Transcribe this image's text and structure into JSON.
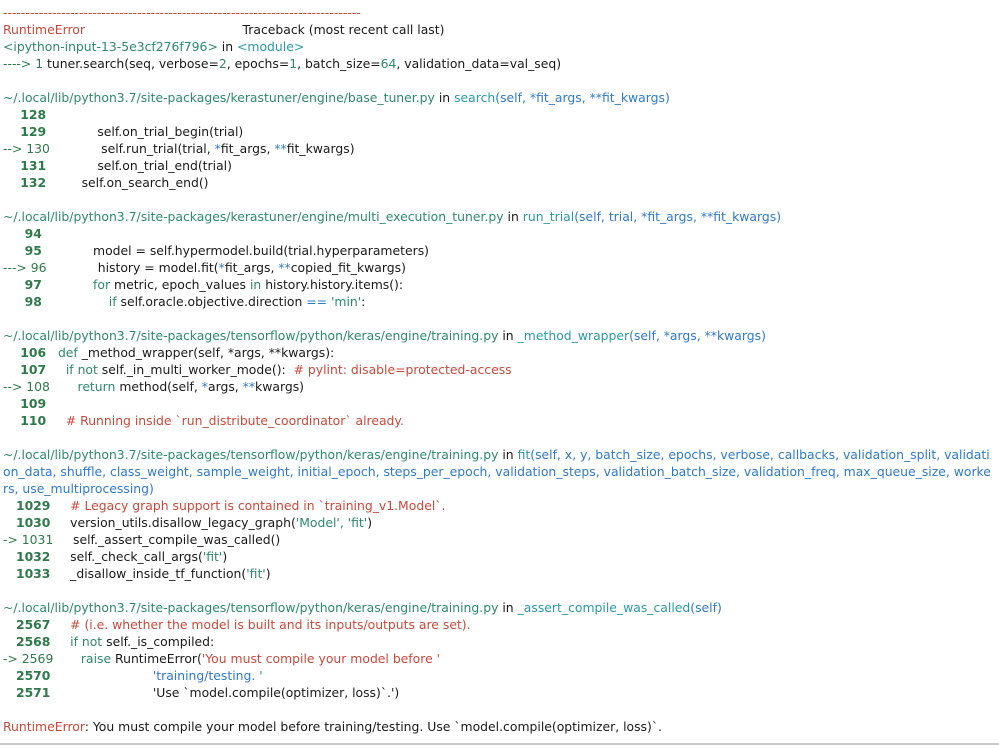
{
  "dashes": "--------------------------------------------------------------------------------",
  "header": {
    "exc_type": "RuntimeError",
    "gap": "                                        ",
    "traceback_label": "Traceback (most recent call last)"
  },
  "input": {
    "ref": "<ipython-input-13-5e3cf276f796>",
    "in": " in ",
    "module": "<module>",
    "arrow": "----> 1 ",
    "code_a": "tuner.search(seq, verbose=",
    "n2": "2",
    "code_b": ", epochs=",
    "n1": "1",
    "code_c": ", batch_size=",
    "n64": "64",
    "code_d": ", validation_data=val_seq)"
  },
  "f1": {
    "path": "~/.local/lib/python3.7/site-packages/kerastuner/engine/base_tuner.py",
    "in": " in ",
    "func": "search",
    "sig_a": "(self, ",
    "star1": "*",
    "sig_b": "fit_args, ",
    "star2": "**",
    "sig_c": "fit_kwargs)",
    "l1": "    128",
    "l2_num": "    129",
    "l2_code": "             self.on_trial_begin(trial)",
    "l3_arr": "--> 130",
    "l3_code_a": "             self.run_trial(trial, ",
    "l3_star1": "*",
    "l3_code_b": "fit_args, ",
    "l3_star2": "**",
    "l3_code_c": "fit_kwargs)",
    "l4_num": "    131",
    "l4_code": "             self.on_trial_end(trial)",
    "l5_num": "    132",
    "l5_code": "         self.on_search_end()"
  },
  "f2": {
    "path": "~/.local/lib/python3.7/site-packages/kerastuner/engine/multi_execution_tuner.py",
    "in": " in ",
    "func": "run_trial",
    "sig_a": "(self, trial, ",
    "star1": "*",
    "sig_b": "fit_args, ",
    "star2": "**",
    "sig_c": "fit_kwargs)",
    "l1": "     94",
    "l2_num": "     95",
    "l2_code": "             model = self.hypermodel.build(trial.hyperparameters)",
    "l3_arr": "---> 96",
    "l3_code_a": "             history = model.fit(",
    "l3_star1": "*",
    "l3_code_b": "fit_args, ",
    "l3_star2": "**",
    "l3_code_c": "copied_fit_kwargs)",
    "l4_num": "     97",
    "l4_for": "             for",
    "l4_code_a": " metric, epoch_values ",
    "l4_in": "in",
    "l4_code_b": " history.history.items():",
    "l5_num": "     98",
    "l5_if": "                 if",
    "l5_code_a": " self.oracle.objective.direction ",
    "l5_eq": "==",
    "l5_str": " 'min'",
    "l5_colon": ":"
  },
  "f3": {
    "path": "~/.local/lib/python3.7/site-packages/tensorflow/python/keras/engine/training.py",
    "in": " in ",
    "func": "_method_wrapper",
    "sig_a": "(self, ",
    "star1": "*",
    "sig_b": "args, ",
    "star2": "**",
    "sig_c": "kwargs)",
    "l1_num": "    106",
    "l1_def": "   def",
    "l1_code": " _method_wrapper(self, *args, **kwargs):",
    "l2_num": "    107",
    "l2_if": "     if",
    "l2_not": " not",
    "l2_code": " self._in_multi_worker_mode():  ",
    "l2_comment": "# pylint: disable=protected-access",
    "l3_arr": "--> 108",
    "l3_ret": "       return",
    "l3_code_a": " method(self, ",
    "l3_star1": "*",
    "l3_code_b": "args, ",
    "l3_star2": "**",
    "l3_code_c": "kwargs)",
    "l4": "    109",
    "l5_num": "    110",
    "l5_comment": "     # Running inside `run_distribute_coordinator` already."
  },
  "f4": {
    "path": "~/.local/lib/python3.7/site-packages/tensorflow/python/keras/engine/training.py",
    "in": " in ",
    "func": "fit",
    "sig": "(self, x, y, batch_size, epochs, verbose, callbacks, validation_split, validation_data, shuffle, class_weight, sample_weight, initial_epoch, steps_per_epoch, validation_steps, validation_batch_size, validation_freq, max_queue_size, workers, use_multiprocessing)",
    "l1_num": "   1029",
    "l1_comment": "     # Legacy graph support is contained in `training_v1.Model`.",
    "l2_num": "   1030",
    "l2_code_a": "     version_utils.disallow_legacy_graph(",
    "l2_str": "'Model', 'fit'",
    "l2_code_b": ")",
    "l3_arr": "-> 1031",
    "l3_code": "     self._assert_compile_was_called()",
    "l4_num": "   1032",
    "l4_code_a": "     self._check_call_args(",
    "l4_str": "'fit'",
    "l4_code_b": ")",
    "l5_num": "   1033",
    "l5_code_a": "     _disallow_inside_tf_function(",
    "l5_str": "'fit'",
    "l5_code_b": ")"
  },
  "f5": {
    "path": "~/.local/lib/python3.7/site-packages/tensorflow/python/keras/engine/training.py",
    "in": " in ",
    "func": "_assert_compile_was_called",
    "sig": "(self)",
    "l1_num": "   2567",
    "l1_comment": "     # (i.e. whether the model is built and its inputs/outputs are set).",
    "l2_num": "   2568",
    "l2_if": "     if",
    "l2_not": " not",
    "l2_code": " self._is_compiled:",
    "l3_arr": "-> 2569",
    "l3_raise": "       raise",
    "l3_code_a": " RuntimeError(",
    "l3_str": "'You must compile your model before '",
    "l4_num": "   2570",
    "l4_pad": "                          ",
    "l4_str": "'training/testing. '",
    "l5_num": "   2571",
    "l5_pad": "                          ",
    "l5_str": "'Use `model.compile(optimizer, loss)`.')"
  },
  "final": {
    "exc_type": "RuntimeError",
    "message": ": You must compile your model before training/testing. Use `model.compile(optimizer, loss)`."
  }
}
